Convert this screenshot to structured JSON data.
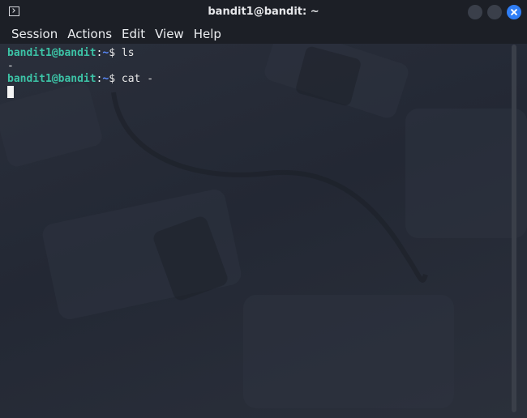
{
  "window": {
    "title": "bandit1@bandit: ~"
  },
  "menu": [
    "Session",
    "Actions",
    "Edit",
    "View",
    "Help"
  ],
  "terminal": {
    "lines": [
      {
        "user": "bandit1@bandit",
        "sep": ":",
        "path": "~",
        "prompt": "$",
        "cmd": " ls"
      },
      {
        "output": "-"
      },
      {
        "user": "bandit1@bandit",
        "sep": ":",
        "path": "~",
        "prompt": "$",
        "cmd": " cat -"
      }
    ]
  },
  "colors": {
    "accent": "#2f7ef6",
    "prompt_user": "#3cc3a6",
    "prompt_path": "#5b8cff"
  }
}
